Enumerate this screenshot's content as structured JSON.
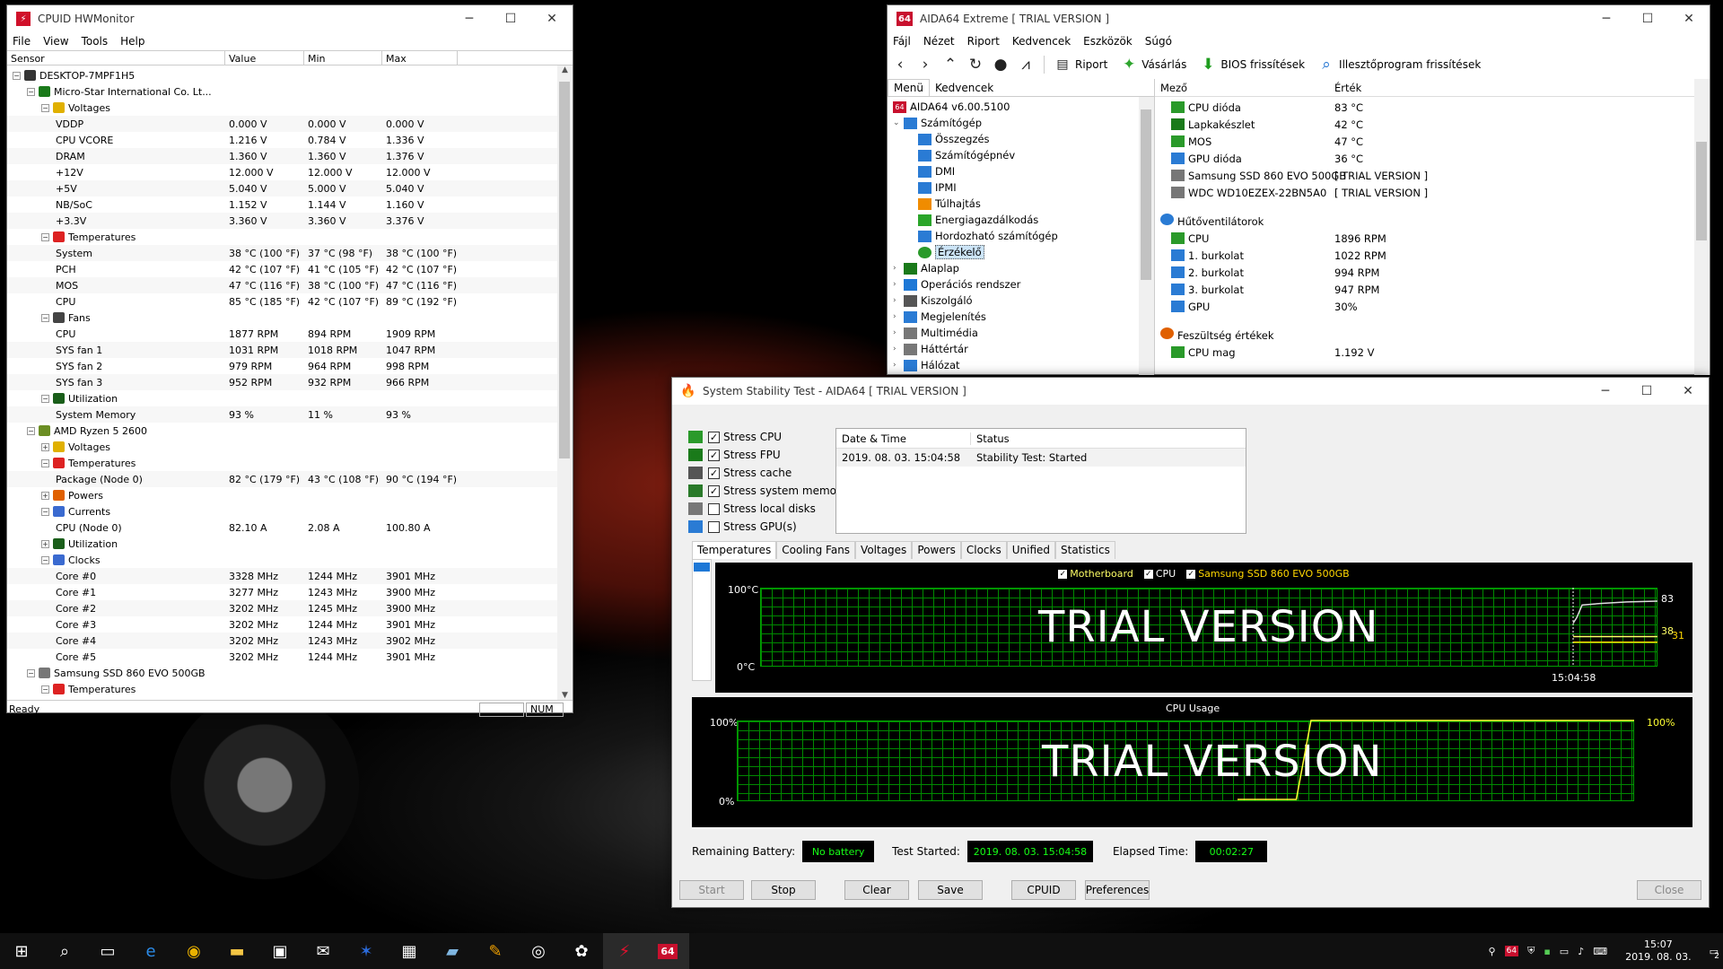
{
  "hwmonitor": {
    "title": "CPUID HWMonitor",
    "menu": [
      "File",
      "View",
      "Tools",
      "Help"
    ],
    "columns": [
      "Sensor",
      "Value",
      "Min",
      "Max"
    ],
    "status": "Ready",
    "num": "NUM",
    "rows": [
      {
        "lvl": 0,
        "exp": "-",
        "icon": "computer-icon",
        "name": "DESKTOP-7MPF1H5",
        "v": "",
        "mn": "",
        "mx": ""
      },
      {
        "lvl": 1,
        "exp": "-",
        "icon": "motherboard-icon",
        "name": "Micro-Star International Co. Lt...",
        "v": "",
        "mn": "",
        "mx": ""
      },
      {
        "lvl": 2,
        "exp": "-",
        "icon": "voltage-icon",
        "name": "Voltages",
        "v": "",
        "mn": "",
        "mx": ""
      },
      {
        "lvl": 3,
        "exp": "",
        "icon": "",
        "name": "VDDP",
        "v": "0.000 V",
        "mn": "0.000 V",
        "mx": "0.000 V"
      },
      {
        "lvl": 3,
        "exp": "",
        "icon": "",
        "name": "CPU VCORE",
        "v": "1.216 V",
        "mn": "0.784 V",
        "mx": "1.336 V"
      },
      {
        "lvl": 3,
        "exp": "",
        "icon": "",
        "name": "DRAM",
        "v": "1.360 V",
        "mn": "1.360 V",
        "mx": "1.376 V"
      },
      {
        "lvl": 3,
        "exp": "",
        "icon": "",
        "name": "+12V",
        "v": "12.000 V",
        "mn": "12.000 V",
        "mx": "12.000 V"
      },
      {
        "lvl": 3,
        "exp": "",
        "icon": "",
        "name": "+5V",
        "v": "5.040 V",
        "mn": "5.000 V",
        "mx": "5.040 V"
      },
      {
        "lvl": 3,
        "exp": "",
        "icon": "",
        "name": "NB/SoC",
        "v": "1.152 V",
        "mn": "1.144 V",
        "mx": "1.160 V"
      },
      {
        "lvl": 3,
        "exp": "",
        "icon": "",
        "name": "+3.3V",
        "v": "3.360 V",
        "mn": "3.360 V",
        "mx": "3.376 V"
      },
      {
        "lvl": 2,
        "exp": "-",
        "icon": "thermometer-icon",
        "name": "Temperatures",
        "v": "",
        "mn": "",
        "mx": ""
      },
      {
        "lvl": 3,
        "exp": "",
        "icon": "",
        "name": "System",
        "v": "38 °C  (100 °F)",
        "mn": "37 °C  (98 °F)",
        "mx": "38 °C  (100 °F)"
      },
      {
        "lvl": 3,
        "exp": "",
        "icon": "",
        "name": "PCH",
        "v": "42 °C  (107 °F)",
        "mn": "41 °C  (105 °F)",
        "mx": "42 °C  (107 °F)"
      },
      {
        "lvl": 3,
        "exp": "",
        "icon": "",
        "name": "MOS",
        "v": "47 °C  (116 °F)",
        "mn": "38 °C  (100 °F)",
        "mx": "47 °C  (116 °F)"
      },
      {
        "lvl": 3,
        "exp": "",
        "icon": "",
        "name": "CPU",
        "v": "85 °C  (185 °F)",
        "mn": "42 °C  (107 °F)",
        "mx": "89 °C  (192 °F)"
      },
      {
        "lvl": 2,
        "exp": "-",
        "icon": "fan-icon",
        "name": "Fans",
        "v": "",
        "mn": "",
        "mx": ""
      },
      {
        "lvl": 3,
        "exp": "",
        "icon": "",
        "name": "CPU",
        "v": "1877 RPM",
        "mn": "894 RPM",
        "mx": "1909 RPM"
      },
      {
        "lvl": 3,
        "exp": "",
        "icon": "",
        "name": "SYS fan 1",
        "v": "1031 RPM",
        "mn": "1018 RPM",
        "mx": "1047 RPM"
      },
      {
        "lvl": 3,
        "exp": "",
        "icon": "",
        "name": "SYS fan 2",
        "v": "979 RPM",
        "mn": "964 RPM",
        "mx": "998 RPM"
      },
      {
        "lvl": 3,
        "exp": "",
        "icon": "",
        "name": "SYS fan 3",
        "v": "952 RPM",
        "mn": "932 RPM",
        "mx": "966 RPM"
      },
      {
        "lvl": 2,
        "exp": "-",
        "icon": "utilization-icon",
        "name": "Utilization",
        "v": "",
        "mn": "",
        "mx": ""
      },
      {
        "lvl": 3,
        "exp": "",
        "icon": "",
        "name": "System Memory",
        "v": "93 %",
        "mn": "11 %",
        "mx": "93 %"
      },
      {
        "lvl": 1,
        "exp": "-",
        "icon": "cpu-chip-icon",
        "name": "AMD Ryzen 5 2600",
        "v": "",
        "mn": "",
        "mx": ""
      },
      {
        "lvl": 2,
        "exp": "+",
        "icon": "voltage-icon",
        "name": "Voltages",
        "v": "",
        "mn": "",
        "mx": ""
      },
      {
        "lvl": 2,
        "exp": "-",
        "icon": "thermometer-icon",
        "name": "Temperatures",
        "v": "",
        "mn": "",
        "mx": ""
      },
      {
        "lvl": 3,
        "exp": "",
        "icon": "",
        "name": "Package (Node 0)",
        "v": "82 °C  (179 °F)",
        "mn": "43 °C  (108 °F)",
        "mx": "90 °C  (194 °F)"
      },
      {
        "lvl": 2,
        "exp": "+",
        "icon": "power-icon",
        "name": "Powers",
        "v": "",
        "mn": "",
        "mx": ""
      },
      {
        "lvl": 2,
        "exp": "-",
        "icon": "current-icon",
        "name": "Currents",
        "v": "",
        "mn": "",
        "mx": ""
      },
      {
        "lvl": 3,
        "exp": "",
        "icon": "",
        "name": "CPU (Node 0)",
        "v": "82.10 A",
        "mn": "2.08 A",
        "mx": "100.80 A"
      },
      {
        "lvl": 2,
        "exp": "+",
        "icon": "utilization-icon",
        "name": "Utilization",
        "v": "",
        "mn": "",
        "mx": ""
      },
      {
        "lvl": 2,
        "exp": "-",
        "icon": "clock-icon",
        "name": "Clocks",
        "v": "",
        "mn": "",
        "mx": ""
      },
      {
        "lvl": 3,
        "exp": "",
        "icon": "",
        "name": "Core #0",
        "v": "3328 MHz",
        "mn": "1244 MHz",
        "mx": "3901 MHz"
      },
      {
        "lvl": 3,
        "exp": "",
        "icon": "",
        "name": "Core #1",
        "v": "3277 MHz",
        "mn": "1243 MHz",
        "mx": "3900 MHz"
      },
      {
        "lvl": 3,
        "exp": "",
        "icon": "",
        "name": "Core #2",
        "v": "3202 MHz",
        "mn": "1245 MHz",
        "mx": "3900 MHz"
      },
      {
        "lvl": 3,
        "exp": "",
        "icon": "",
        "name": "Core #3",
        "v": "3202 MHz",
        "mn": "1244 MHz",
        "mx": "3901 MHz"
      },
      {
        "lvl": 3,
        "exp": "",
        "icon": "",
        "name": "Core #4",
        "v": "3202 MHz",
        "mn": "1243 MHz",
        "mx": "3902 MHz"
      },
      {
        "lvl": 3,
        "exp": "",
        "icon": "",
        "name": "Core #5",
        "v": "3202 MHz",
        "mn": "1244 MHz",
        "mx": "3901 MHz"
      },
      {
        "lvl": 1,
        "exp": "-",
        "icon": "drive-icon",
        "name": "Samsung SSD 860 EVO 500GB",
        "v": "",
        "mn": "",
        "mx": ""
      },
      {
        "lvl": 2,
        "exp": "-",
        "icon": "thermometer-icon",
        "name": "Temperatures",
        "v": "",
        "mn": "",
        "mx": ""
      }
    ]
  },
  "aida": {
    "title": "AIDA64 Extreme  [ TRIAL VERSION ]",
    "app_badge": "64",
    "menu": [
      "Fájl",
      "Nézet",
      "Riport",
      "Kedvencek",
      "Eszközök",
      "Súgó"
    ],
    "toolbar": {
      "report": "Riport",
      "buy": "Vásárlás",
      "bios": "BIOS frissítések",
      "driver": "Illesztőprogram frissítések"
    },
    "tabs": [
      "Menü",
      "Kedvencek"
    ],
    "version": "AIDA64 v6.00.5100",
    "tree": [
      {
        "lvl": 0,
        "exp": "v",
        "name": "Számítógép",
        "icon": "computer-icon"
      },
      {
        "lvl": 1,
        "exp": "",
        "name": "Összegzés",
        "icon": "summary-icon"
      },
      {
        "lvl": 1,
        "exp": "",
        "name": "Számítógépnév",
        "icon": "computer-name-icon"
      },
      {
        "lvl": 1,
        "exp": "",
        "name": "DMI",
        "icon": "dmi-icon"
      },
      {
        "lvl": 1,
        "exp": "",
        "name": "IPMI",
        "icon": "ipmi-icon"
      },
      {
        "lvl": 1,
        "exp": "",
        "name": "Túlhajtás",
        "icon": "overclock-icon"
      },
      {
        "lvl": 1,
        "exp": "",
        "name": "Energiagazdálkodás",
        "icon": "power-icon"
      },
      {
        "lvl": 1,
        "exp": "",
        "name": "Hordozható számítógép",
        "icon": "laptop-icon"
      },
      {
        "lvl": 1,
        "exp": "",
        "name": "Érzékelő",
        "icon": "sensor-icon",
        "sel": true
      },
      {
        "lvl": 0,
        "exp": ">",
        "name": "Alaplap",
        "icon": "motherboard-icon"
      },
      {
        "lvl": 0,
        "exp": ">",
        "name": "Operációs rendszer",
        "icon": "windows-icon"
      },
      {
        "lvl": 0,
        "exp": ">",
        "name": "Kiszolgáló",
        "icon": "server-icon"
      },
      {
        "lvl": 0,
        "exp": ">",
        "name": "Megjelenítés",
        "icon": "display-icon"
      },
      {
        "lvl": 0,
        "exp": ">",
        "name": "Multimédia",
        "icon": "multimedia-icon"
      },
      {
        "lvl": 0,
        "exp": ">",
        "name": "Háttértár",
        "icon": "storage-icon"
      },
      {
        "lvl": 0,
        "exp": ">",
        "name": "Hálózat",
        "icon": "network-icon"
      }
    ],
    "cols": [
      "Mező",
      "Érték"
    ],
    "fields": [
      {
        "type": "row",
        "icon": "cpu-icon",
        "f": "CPU dióda",
        "v": "83 °C"
      },
      {
        "type": "row",
        "icon": "motherboard-icon",
        "f": "Lapkakészlet",
        "v": "42 °C"
      },
      {
        "type": "row",
        "icon": "mos-icon",
        "f": "MOS",
        "v": "47 °C"
      },
      {
        "type": "row",
        "icon": "gpu-icon",
        "f": "GPU dióda",
        "v": "36 °C"
      },
      {
        "type": "row",
        "icon": "ssd-icon",
        "f": "Samsung SSD 860 EVO 500GB",
        "v": "[ TRIAL VERSION ]"
      },
      {
        "type": "row",
        "icon": "hdd-icon",
        "f": "WDC WD10EZEX-22BN5A0",
        "v": "[ TRIAL VERSION ]"
      },
      {
        "type": "gap"
      },
      {
        "type": "group",
        "icon": "fan-icon",
        "f": "Hűtőventilátorok"
      },
      {
        "type": "row",
        "icon": "cpu-icon",
        "f": "CPU",
        "v": "1896 RPM"
      },
      {
        "type": "row",
        "icon": "case-icon",
        "f": "1. burkolat",
        "v": "1022 RPM"
      },
      {
        "type": "row",
        "icon": "case-icon",
        "f": "2. burkolat",
        "v": "994 RPM"
      },
      {
        "type": "row",
        "icon": "case-icon",
        "f": "3. burkolat",
        "v": "947 RPM"
      },
      {
        "type": "row",
        "icon": "gpu-icon",
        "f": "GPU",
        "v": "30%"
      },
      {
        "type": "gap"
      },
      {
        "type": "group",
        "icon": "voltage-icon",
        "f": "Feszültség értékek"
      },
      {
        "type": "row",
        "icon": "cpu-icon",
        "f": "CPU mag",
        "v": "1.192 V"
      }
    ]
  },
  "sst": {
    "title": "System Stability Test - AIDA64  [ TRIAL VERSION ]",
    "checks": [
      {
        "label": "Stress CPU",
        "checked": true,
        "icon": "cpu-icon"
      },
      {
        "label": "Stress FPU",
        "checked": true,
        "icon": "fpu-icon"
      },
      {
        "label": "Stress cache",
        "checked": true,
        "icon": "cache-icon"
      },
      {
        "label": "Stress system memory",
        "checked": true,
        "icon": "memory-icon"
      },
      {
        "label": "Stress local disks",
        "checked": false,
        "icon": "disk-icon"
      },
      {
        "label": "Stress GPU(s)",
        "checked": false,
        "icon": "gpu-icon"
      }
    ],
    "log_cols": [
      "Date & Time",
      "Status"
    ],
    "log_rows": [
      {
        "dt": "2019. 08. 03. 15:04:58",
        "st": "Stability Test: Started"
      }
    ],
    "tabs": [
      "Temperatures",
      "Cooling Fans",
      "Voltages",
      "Powers",
      "Clocks",
      "Unified",
      "Statistics"
    ],
    "temp_graph": {
      "legend": [
        "Motherboard",
        "CPU",
        "Samsung SSD 860 EVO 500GB"
      ],
      "ymax": "100°C",
      "ymin": "0°C",
      "time": "15:04:58",
      "watermark": "TRIAL VERSION",
      "vals": [
        "83",
        "38",
        "31"
      ],
      "colors": {
        "cpu": "#dddddd",
        "mb": "#ffff66",
        "ssd": "#ffd700"
      }
    },
    "cpu_graph": {
      "title": "CPU Usage",
      "ymax": "100%",
      "ymin": "0%",
      "val": "100%",
      "watermark": "TRIAL VERSION"
    },
    "battery_label": "Remaining Battery:",
    "battery": "No battery",
    "started_label": "Test Started:",
    "started": "2019. 08. 03. 15:04:58",
    "elapsed_label": "Elapsed Time:",
    "elapsed": "00:02:27",
    "buttons": {
      "start": "Start",
      "stop": "Stop",
      "clear": "Clear",
      "save": "Save",
      "cpuid": "CPUID",
      "prefs": "Preferences",
      "close": "Close"
    }
  },
  "taskbar": {
    "time": "15:07",
    "date": "2019. 08. 03.",
    "notif": "2"
  },
  "chart_data": [
    {
      "type": "line",
      "title": "",
      "legend": [
        "Motherboard",
        "CPU",
        "Samsung SSD 860 EVO 500GB"
      ],
      "ylim": [
        0,
        100
      ],
      "ylabel": "°C",
      "x_tick_labels": [
        "15:04:58"
      ],
      "series": [
        {
          "name": "CPU",
          "last_value": 83
        },
        {
          "name": "Motherboard",
          "last_value": 38
        },
        {
          "name": "Samsung SSD 860 EVO 500GB",
          "last_value": 31
        }
      ]
    },
    {
      "type": "line",
      "title": "CPU Usage",
      "ylim": [
        0,
        100
      ],
      "ylabel": "%",
      "series": [
        {
          "name": "CPU Usage",
          "values": [
            0,
            0,
            0,
            0,
            0,
            100,
            100,
            100,
            100,
            100,
            100,
            100,
            100,
            100,
            100,
            100,
            100,
            100,
            100,
            100,
            100,
            100,
            100,
            100,
            100,
            100,
            100,
            100
          ]
        }
      ]
    }
  ]
}
